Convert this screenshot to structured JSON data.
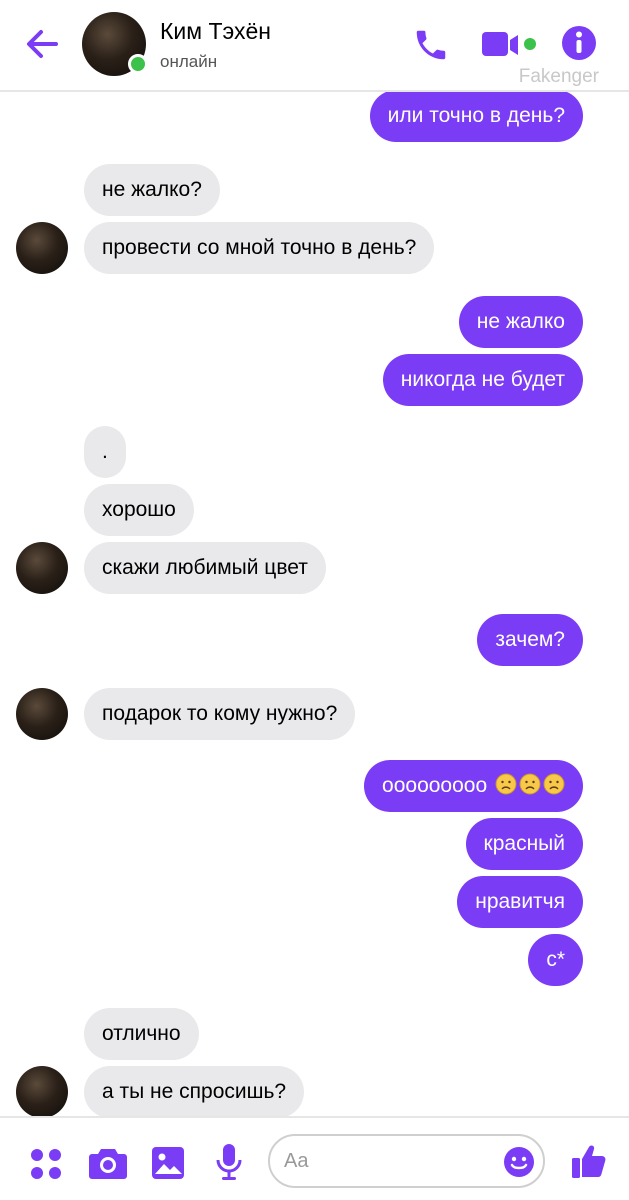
{
  "header": {
    "contact_name": "Ким Тэхён",
    "status": "онлайн",
    "watermark": "Fakenger"
  },
  "colors": {
    "accent": "#7b3cf5",
    "incoming_bubble": "#e9e9eb",
    "online": "#3cc24a"
  },
  "messages": {
    "m0": "или точно в день?",
    "m1": "не жалко?",
    "m2": "провести со мной точно в день?",
    "m3": "не жалко",
    "m4": "никогда не будет",
    "m5": ".",
    "m6": "хорошо",
    "m7": "скажи любимый цвет",
    "m8": "зачем?",
    "m9": "подарок то кому нужно?",
    "m10": "ооооооооо",
    "m11": "красный",
    "m12": "нравитчя",
    "m13": "с*",
    "m14": "отлично",
    "m15": "а ты не спросишь?"
  },
  "composer": {
    "placeholder": "Aa"
  },
  "icons": [
    "back-arrow-icon",
    "phone-icon",
    "video-camera-icon",
    "info-icon",
    "apps-grid-icon",
    "camera-icon",
    "image-icon",
    "microphone-icon",
    "emoji-icon",
    "thumbs-up-icon",
    "sad-face-icon"
  ]
}
